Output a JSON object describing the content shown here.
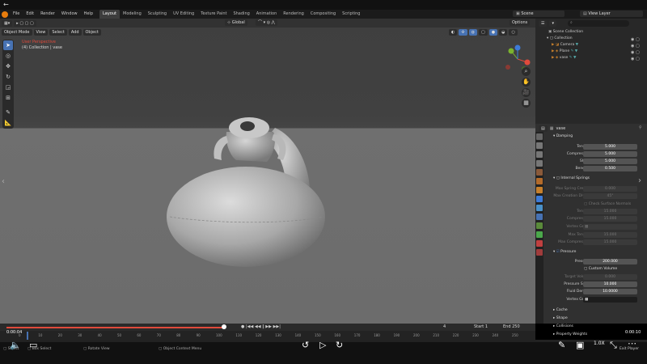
{
  "window": {
    "back_glyph": "←",
    "scene": "Scene",
    "view_layer": "View Layer"
  },
  "menu": [
    "File",
    "Edit",
    "Render",
    "Window",
    "Help"
  ],
  "workspaces": [
    "Layout",
    "Modeling",
    "Sculpting",
    "UV Editing",
    "Texture Paint",
    "Shading",
    "Animation",
    "Rendering",
    "Compositing",
    "Scripting"
  ],
  "viewport": {
    "mode": "Object Mode",
    "menus": [
      "View",
      "Select",
      "Add",
      "Object"
    ],
    "orientation": "Global",
    "options": "Options",
    "overlay_line1": "User Perspective",
    "overlay_line2": "(4) Collection | vase"
  },
  "outliner": {
    "root": "Scene Collection",
    "collection": "Collection",
    "items": [
      "Camera",
      "Plane",
      "vase"
    ]
  },
  "properties": {
    "object": "vase",
    "damping_header": "Damping",
    "damping": [
      {
        "label": "Tension",
        "value": "5.000"
      },
      {
        "label": "Compression",
        "value": "5.000"
      },
      {
        "label": "Shear",
        "value": "5.000"
      },
      {
        "label": "Bending",
        "value": "0.500"
      }
    ],
    "internal_springs_header": "Internal Springs",
    "internal_springs": [
      {
        "label": "Max Spring Creat...",
        "value": "0.000"
      },
      {
        "label": "Max Creation Dive...",
        "value": "45°"
      }
    ],
    "check_surface_normals": "Check Surface Normals",
    "internal_springs2": [
      {
        "label": "Tension",
        "value": "15.000"
      },
      {
        "label": "Compression",
        "value": "15.000"
      }
    ],
    "vertex_group_label": "Vertex Group",
    "internal_springs3": [
      {
        "label": "Max Tension",
        "value": "15.000"
      },
      {
        "label": "Max Compression",
        "value": "15.000"
      }
    ],
    "pressure_header": "Pressure",
    "pressure": {
      "label": "Pressure",
      "value": "200.000"
    },
    "custom_volume": "Custom Volume",
    "target_volume": {
      "label": "Target Volume",
      "value": "0.000"
    },
    "pressure_scale": {
      "label": "Pressure Scale",
      "value": "10.000"
    },
    "fluid_density": {
      "label": "Fluid Density",
      "value": "10.0000"
    },
    "vertex_group2_label": "Vertex Group",
    "sections": [
      "Cache",
      "Shape",
      "Collisions",
      "Property Weights"
    ]
  },
  "timeline": {
    "time_start": "0:00:04",
    "time_end": "0:00:10",
    "current_frame": "4",
    "start_label": "Start",
    "start_value": "1",
    "end_label": "End",
    "end_value": "250",
    "playback_progress": 0.38,
    "ticks": [
      "0",
      "10",
      "20",
      "30",
      "40",
      "50",
      "60",
      "70",
      "80",
      "90",
      "100",
      "110",
      "120",
      "130",
      "140",
      "150",
      "160",
      "170",
      "180",
      "190",
      "200",
      "210",
      "220",
      "230",
      "240",
      "250"
    ]
  },
  "status": {
    "select": "Select",
    "box_select": "Box Select",
    "rotate_view": "Rotate View",
    "context_menu": "Object Context Menu",
    "speed": "1.0X",
    "exit_player": "Exit Player"
  },
  "colors": {
    "accent": "#4772b3",
    "timeline_red": "#e04a3b"
  }
}
